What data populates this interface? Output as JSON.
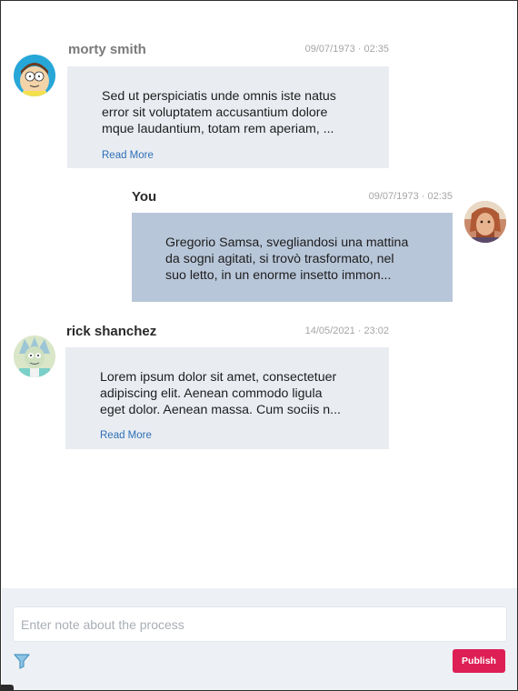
{
  "messages": [
    {
      "author": "morty smith",
      "timestamp": "09/07/1973 · 02:35",
      "text": "Sed ut perspiciatis unde omnis iste natus error sit voluptatem accusantium dolore mque laudantium, totam rem aperiam, ...",
      "read_more": "Read More",
      "avatar_icon": "morty-avatar"
    },
    {
      "author": "You",
      "timestamp": "09/07/1973 · 02:35",
      "text": "Gregorio Samsa, svegliandosi una mattina da sogni agitati, si trovò trasformato, nel suo letto, in un enorme insetto immon...",
      "avatar_icon": "user-avatar"
    },
    {
      "author": "rick shanchez",
      "timestamp": "14/05/2021 · 23:02",
      "text": "Lorem ipsum dolor sit amet, consectetuer adipiscing elit. Aenean commodo ligula eget dolor. Aenean massa. Cum sociis n...",
      "read_more": "Read More",
      "avatar_icon": "rick-avatar"
    }
  ],
  "composer": {
    "placeholder": "Enter note about the process",
    "filter_icon": "filter-icon",
    "publish_label": "Publish"
  },
  "colors": {
    "bubble_other": "#e9edf2",
    "bubble_mine": "#b8c6d9",
    "publish": "#dd1f55",
    "link": "#2f6fb6"
  }
}
